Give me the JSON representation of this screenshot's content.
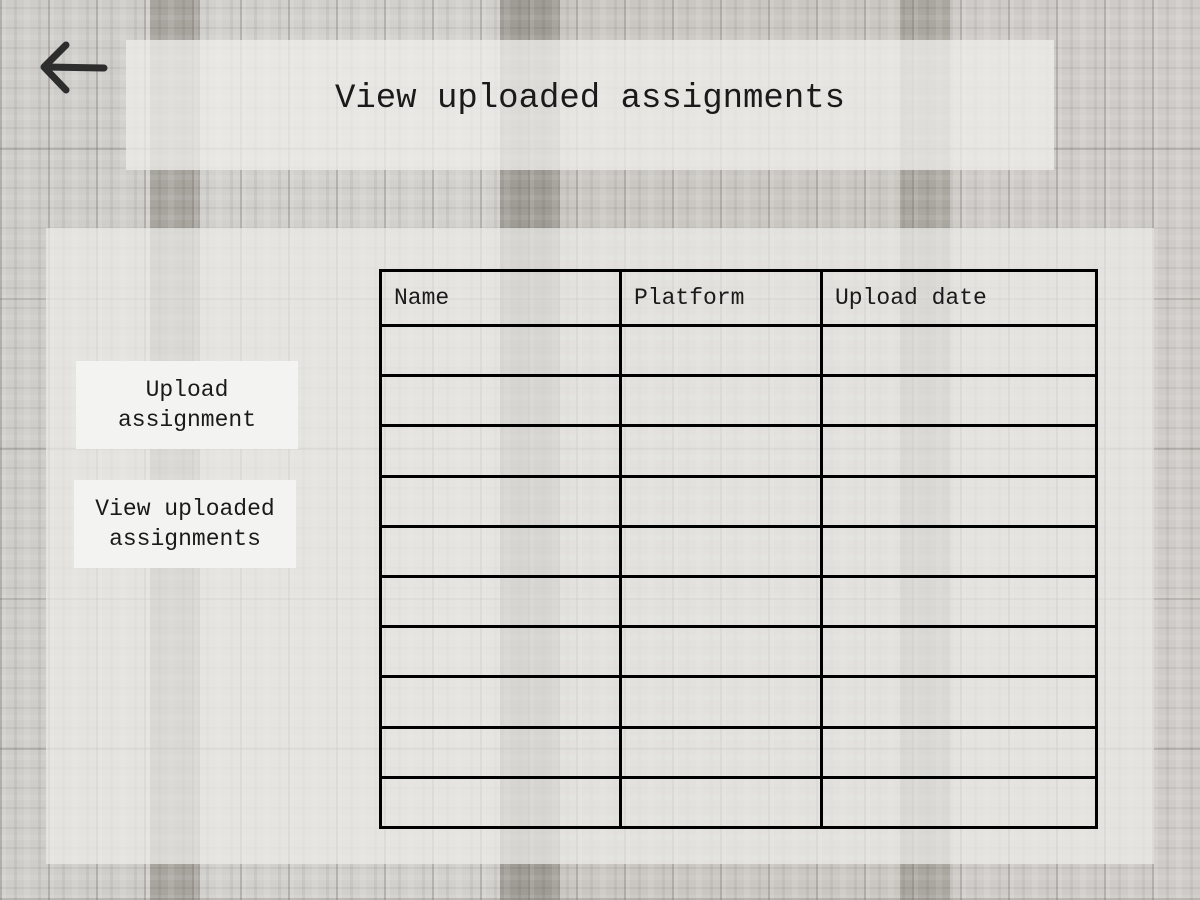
{
  "header": {
    "title": "View uploaded assignments",
    "back_icon": "arrow-left-icon"
  },
  "sidebar": {
    "upload_button": "Upload\nassignment",
    "view_button": "View uploaded\nassignments"
  },
  "table": {
    "columns": [
      "Name",
      "Platform",
      "Upload date"
    ],
    "rows": [
      [
        "",
        "",
        ""
      ],
      [
        "",
        "",
        ""
      ],
      [
        "",
        "",
        ""
      ],
      [
        "",
        "",
        ""
      ],
      [
        "",
        "",
        ""
      ],
      [
        "",
        "",
        ""
      ],
      [
        "",
        "",
        ""
      ],
      [
        "",
        "",
        ""
      ],
      [
        "",
        "",
        ""
      ],
      [
        "",
        "",
        ""
      ]
    ]
  },
  "colors": {
    "panel": "#eeedeb",
    "button": "#f3f3f2",
    "grid_line": "#000000",
    "text": "#1a1a1a"
  }
}
